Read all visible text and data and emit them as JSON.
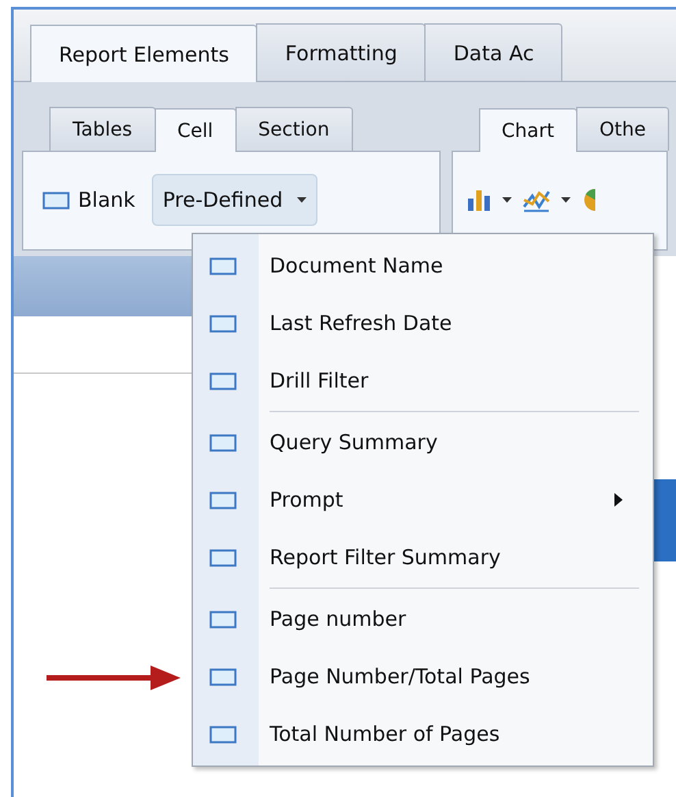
{
  "main_tabs": [
    {
      "label": "Report Elements",
      "selected": true
    },
    {
      "label": "Formatting",
      "selected": false
    },
    {
      "label": "Data Ac",
      "selected": false
    }
  ],
  "sub_tab_groups": [
    [
      {
        "label": "Tables",
        "selected": false
      },
      {
        "label": "Cell",
        "selected": true
      },
      {
        "label": "Section",
        "selected": false
      }
    ],
    [
      {
        "label": "Chart",
        "selected": true
      },
      {
        "label": "Othe",
        "selected": false
      }
    ]
  ],
  "toolbar": {
    "blank_button": "Blank",
    "predefined_dropdown": {
      "label": "Pre-Defined",
      "open": true
    }
  },
  "menu": [
    {
      "kind": "item",
      "label": "Document Name",
      "submenu": false
    },
    {
      "kind": "item",
      "label": "Last Refresh Date",
      "submenu": false
    },
    {
      "kind": "item",
      "label": "Drill Filter",
      "submenu": false
    },
    {
      "kind": "separator"
    },
    {
      "kind": "item",
      "label": "Query Summary",
      "submenu": false
    },
    {
      "kind": "item",
      "label": "Prompt",
      "submenu": true
    },
    {
      "kind": "item",
      "label": "Report Filter Summary",
      "submenu": false
    },
    {
      "kind": "separator"
    },
    {
      "kind": "item",
      "label": "Page number",
      "submenu": false
    },
    {
      "kind": "item",
      "label": "Page Number/Total Pages",
      "submenu": false,
      "pointed": true
    },
    {
      "kind": "item",
      "label": "Total Number of Pages",
      "submenu": false
    }
  ]
}
